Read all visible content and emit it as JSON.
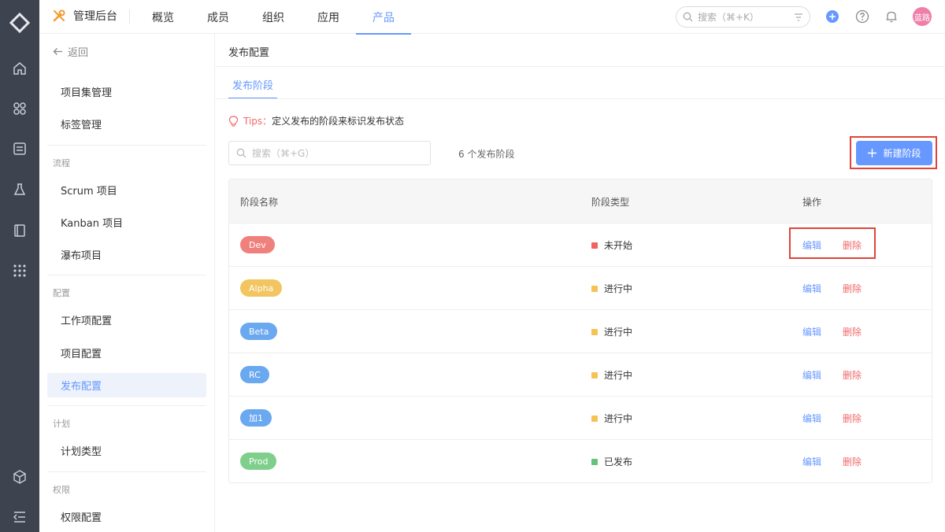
{
  "topbar": {
    "app_title": "管理后台",
    "nav": [
      {
        "label": "概览",
        "active": false
      },
      {
        "label": "成员",
        "active": false
      },
      {
        "label": "组织",
        "active": false
      },
      {
        "label": "应用",
        "active": false
      },
      {
        "label": "产品",
        "active": true
      }
    ],
    "search_placeholder": "搜索（⌘+K）",
    "avatar_text": "蓝路",
    "accent_color": "#6698ff"
  },
  "rail": {
    "icons": [
      "home-icon",
      "apps-icon",
      "task-list-icon",
      "flask-icon",
      "book-icon",
      "grid-dots-icon",
      "cube-icon",
      "menu-collapse-icon"
    ]
  },
  "sidebar": {
    "back_label": "返回",
    "items": [
      {
        "label": "项目集管理"
      },
      {
        "label": "标签管理"
      },
      {
        "group": "流程"
      },
      {
        "label": "Scrum 项目"
      },
      {
        "label": "Kanban 项目"
      },
      {
        "label": "瀑布项目"
      },
      {
        "group": "配置"
      },
      {
        "label": "工作项配置"
      },
      {
        "label": "项目配置"
      },
      {
        "label": "发布配置",
        "active": true
      },
      {
        "group": "计划"
      },
      {
        "label": "计划类型"
      },
      {
        "group": "权限"
      },
      {
        "label": "权限配置"
      }
    ]
  },
  "main": {
    "page_title": "发布配置",
    "tab_label": "发布阶段",
    "tips_label": "Tips：",
    "tips_text": "定义发布的阶段来标识发布状态",
    "search_placeholder": "搜索（⌘+G）",
    "count_text": "6 个发布阶段",
    "new_button_label": "新建阶段",
    "table": {
      "columns": [
        "阶段名称",
        "阶段类型",
        "操作"
      ],
      "rows": [
        {
          "name": "Dev",
          "name_color": "#f0807c",
          "type": "未开始",
          "type_color": "#ef6361",
          "edit": "编辑",
          "delete": "删除"
        },
        {
          "name": "Alpha",
          "name_color": "#f2c560",
          "type": "进行中",
          "type_color": "#f5c355",
          "edit": "编辑",
          "delete": "删除"
        },
        {
          "name": "Beta",
          "name_color": "#6aa8f0",
          "type": "进行中",
          "type_color": "#f5c355",
          "edit": "编辑",
          "delete": "删除"
        },
        {
          "name": "RC",
          "name_color": "#6aa8f0",
          "type": "进行中",
          "type_color": "#f5c355",
          "edit": "编辑",
          "delete": "删除"
        },
        {
          "name": "加1",
          "name_color": "#6aa8f0",
          "type": "进行中",
          "type_color": "#f5c355",
          "edit": "编辑",
          "delete": "删除"
        },
        {
          "name": "Prod",
          "name_color": "#7fcf8c",
          "type": "已发布",
          "type_color": "#66c17a",
          "edit": "编辑",
          "delete": "删除"
        }
      ]
    }
  }
}
